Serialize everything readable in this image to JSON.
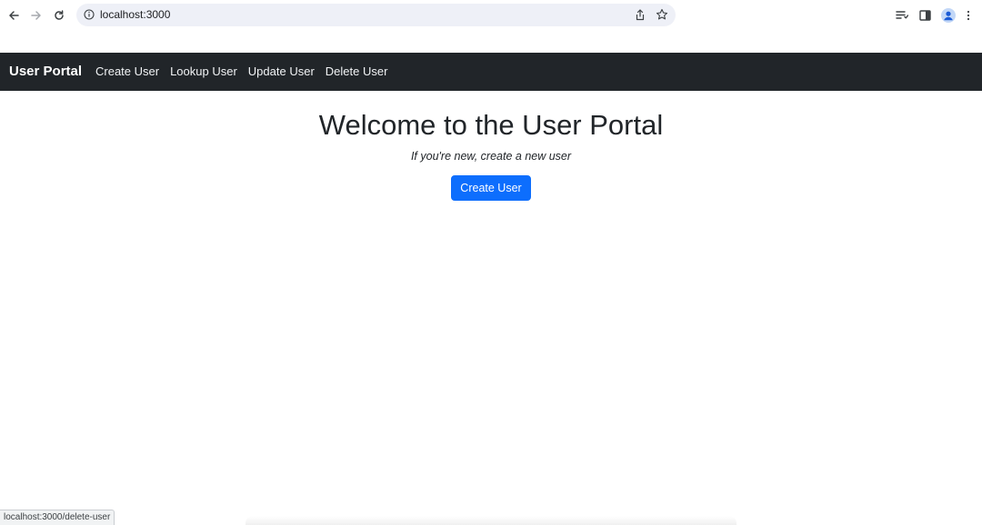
{
  "browser": {
    "url": "localhost:3000",
    "icons": {
      "back": "arrow-left-icon",
      "forward": "arrow-right-icon",
      "reload": "reload-icon",
      "site_info": "info-icon",
      "share": "share-icon",
      "bookmark": "star-icon",
      "reading_list": "reading-list-icon",
      "side_panel": "side-panel-icon",
      "profile": "profile-icon",
      "menu": "kebab-menu-icon"
    },
    "status_bar_url": "localhost:3000/delete-user"
  },
  "navbar": {
    "brand": "User Portal",
    "links": [
      {
        "label": "Create User"
      },
      {
        "label": "Lookup User"
      },
      {
        "label": "Update User"
      },
      {
        "label": "Delete User"
      }
    ],
    "background": "#212529"
  },
  "main": {
    "title": "Welcome to the User Portal",
    "subtitle": "If you're new, create a new user",
    "cta_label": "Create User",
    "cta_color": "#0d6efd"
  }
}
